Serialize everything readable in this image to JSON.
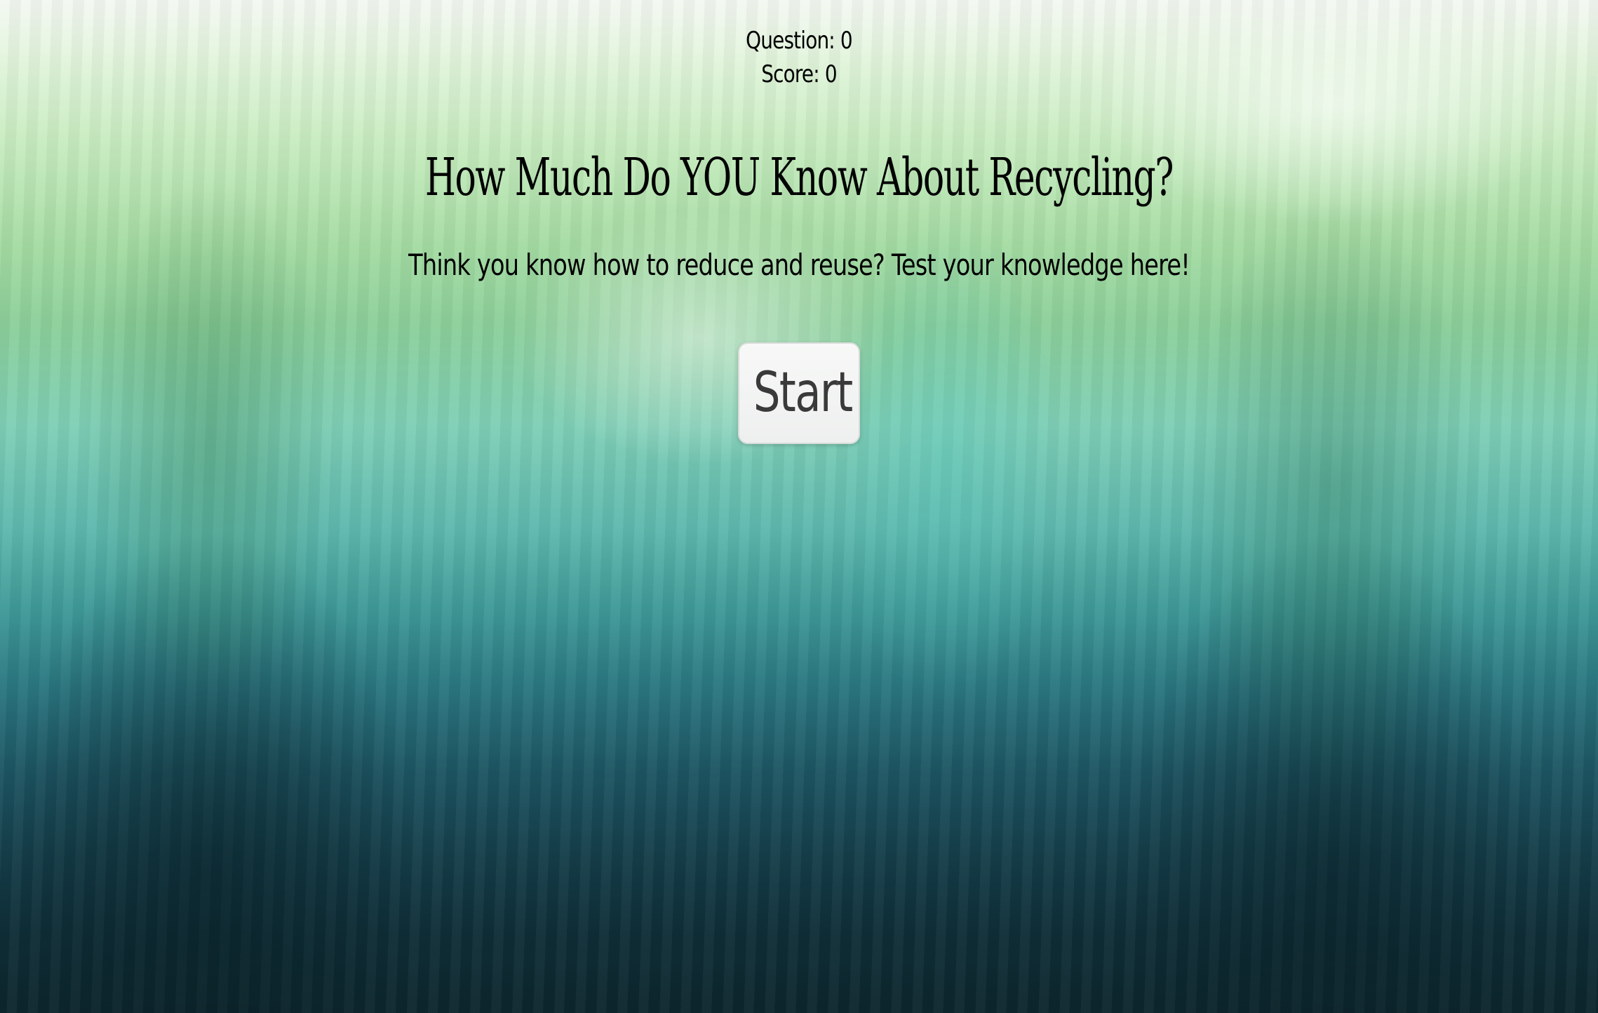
{
  "hud": {
    "question_text": "Question: 0",
    "score_text": "Score: 0"
  },
  "header": {
    "title": "How Much Do YOU Know About Recycling?",
    "subtitle": "Think you know how to reduce and reuse? Test your knowledge here!"
  },
  "actions": {
    "start_label": "Start"
  }
}
